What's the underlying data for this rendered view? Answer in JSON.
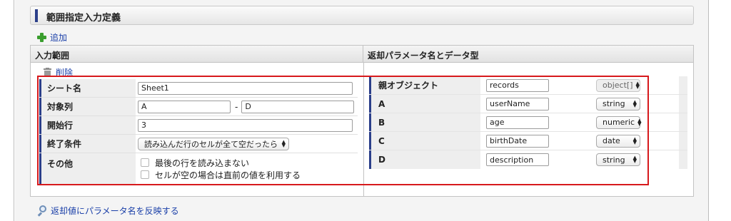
{
  "section": {
    "title": "範囲指定入力定義"
  },
  "add_label": "追加",
  "columns": {
    "input_range": "入力範囲",
    "return_params": "返却パラメータ名とデータ型"
  },
  "delete_label": "削除",
  "input": {
    "sheet": {
      "label": "シート名",
      "value": "Sheet1"
    },
    "columns": {
      "label": "対象列",
      "from": "A",
      "separator": "-",
      "to": "D"
    },
    "start_row": {
      "label": "開始行",
      "value": "3"
    },
    "end_condition": {
      "label": "終了条件",
      "value": "読み込んだ行のセルが全て空だったら"
    },
    "other": {
      "label": "その他",
      "options": [
        {
          "label": "最後の行を読み込まない",
          "checked": false
        },
        {
          "label": "セルが空の場合は直前の値を利用する",
          "checked": false
        }
      ]
    }
  },
  "return_params": {
    "parent": {
      "label": "親オブジェクト",
      "name": "records",
      "type": "object[]"
    },
    "rows": [
      {
        "label": "A",
        "name": "userName",
        "type": "string"
      },
      {
        "label": "B",
        "name": "age",
        "type": "numeric"
      },
      {
        "label": "C",
        "name": "birthDate",
        "type": "date"
      },
      {
        "label": "D",
        "name": "description",
        "type": "string"
      }
    ]
  },
  "reflect_label": "返却値にパラメータ名を反映する",
  "colors": {
    "accent": "#2b3f8a",
    "highlight": "#d7191c",
    "link": "#1a3fa8",
    "add": "#3a9e2e"
  }
}
